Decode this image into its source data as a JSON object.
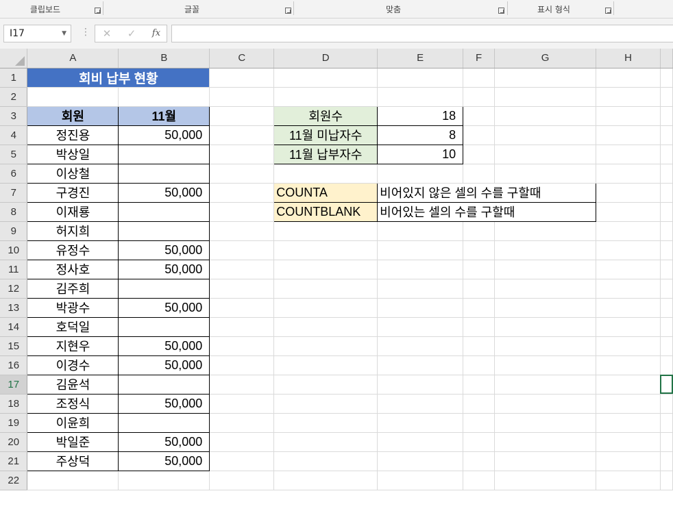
{
  "ribbon": {
    "groups": [
      "클립보드",
      "글꼴",
      "맞춤",
      "표시 형식"
    ]
  },
  "formula_bar": {
    "name_box": "I17",
    "cancel_icon": "✕",
    "enter_icon": "✓",
    "fx_label": "fx",
    "formula": ""
  },
  "columns": [
    "A",
    "B",
    "C",
    "D",
    "E",
    "F",
    "G",
    "H"
  ],
  "rows": [
    "1",
    "2",
    "3",
    "4",
    "5",
    "6",
    "7",
    "8",
    "9",
    "10",
    "11",
    "12",
    "13",
    "14",
    "15",
    "16",
    "17",
    "18",
    "19",
    "20",
    "21",
    "22"
  ],
  "sheet": {
    "title": "회비 납부 현황",
    "header_member": "회원",
    "header_month": "11월",
    "members": [
      {
        "name": "정진용",
        "paid": "50,000"
      },
      {
        "name": "박상일",
        "paid": ""
      },
      {
        "name": "이상철",
        "paid": ""
      },
      {
        "name": "구경진",
        "paid": "50,000"
      },
      {
        "name": "이재룡",
        "paid": ""
      },
      {
        "name": "허지희",
        "paid": ""
      },
      {
        "name": "유정수",
        "paid": "50,000"
      },
      {
        "name": "정사호",
        "paid": "50,000"
      },
      {
        "name": "김주희",
        "paid": ""
      },
      {
        "name": "박광수",
        "paid": "50,000"
      },
      {
        "name": "호덕일",
        "paid": ""
      },
      {
        "name": "지현우",
        "paid": "50,000"
      },
      {
        "name": "이경수",
        "paid": "50,000"
      },
      {
        "name": "김윤석",
        "paid": ""
      },
      {
        "name": "조정식",
        "paid": "50,000"
      },
      {
        "name": "이윤희",
        "paid": ""
      },
      {
        "name": "박일준",
        "paid": "50,000"
      },
      {
        "name": "주상덕",
        "paid": "50,000"
      }
    ],
    "summary": [
      {
        "label": "회원수",
        "value": "18"
      },
      {
        "label": "11월 미납자수",
        "value": "8"
      },
      {
        "label": "11월 납부자수",
        "value": "10"
      }
    ],
    "functions": [
      {
        "name": "COUNTA",
        "desc": "비어있지 않은 셀의 수를 구할때"
      },
      {
        "name": "COUNTBLANK",
        "desc": "비어있는 셀의 수를 구할때"
      }
    ]
  },
  "colors": {
    "title_bg": "#4472c4",
    "header_bg": "#b4c6e7",
    "summary_bg": "#e2efda",
    "function_bg": "#fff2cc",
    "selection": "#217346"
  }
}
